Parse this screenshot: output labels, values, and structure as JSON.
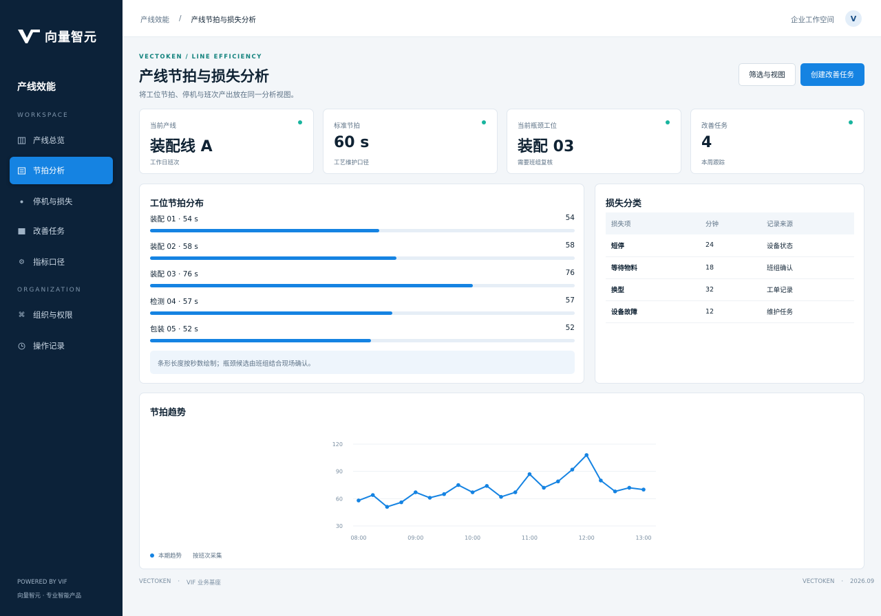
{
  "sidebar": {
    "brand": "向量智元",
    "title": "产线效能",
    "section_workspace": "WORKSPACE",
    "section_org": "ORGANIZATION",
    "items": [
      {
        "label": "产线总览",
        "icon": "columns-icon"
      },
      {
        "label": "节拍分析",
        "icon": "list-icon",
        "active": true
      },
      {
        "label": "停机与损失",
        "icon": "dot-icon"
      },
      {
        "label": "改善任务",
        "icon": "grid-icon"
      },
      {
        "label": "指标口径",
        "icon": "gear-icon"
      },
      {
        "label": "组织与权限",
        "icon": "command-icon"
      },
      {
        "label": "操作记录",
        "icon": "clock-icon"
      }
    ],
    "footer_line1": "POWERED BY VIF",
    "footer_line2": "向量智元 · 专业智能产品"
  },
  "topbar": {
    "breadcrumb_root": "产线效能",
    "breadcrumb_sep": "/",
    "breadcrumb_current": "产线节拍与损失分析",
    "workspace": "企业工作空间",
    "avatar": "V"
  },
  "header": {
    "eyebrow": "VECTOKEN / LINE EFFICIENCY",
    "title": "产线节拍与损失分析",
    "subtitle": "将工位节拍、停机与班次产出放在同一分析视图。",
    "filter_button": "筛选与视图",
    "create_button": "创建改善任务"
  },
  "kpis": [
    {
      "label": "当前产线",
      "value": "装配线 A",
      "sub": "工作日班次"
    },
    {
      "label": "标准节拍",
      "value": "60 s",
      "sub": "工艺维护口径"
    },
    {
      "label": "当前瓶颈工位",
      "value": "装配 03",
      "sub": "需要班组复核"
    },
    {
      "label": "改善任务",
      "value": "4",
      "sub": "本周跟踪"
    }
  ],
  "distribution": {
    "title": "工位节拍分布",
    "max": 100,
    "rows": [
      {
        "label": "装配 01 · 54 s",
        "value": 54,
        "display": "54"
      },
      {
        "label": "装配 02 · 58 s",
        "value": 58,
        "display": "58"
      },
      {
        "label": "装配 03 · 76 s",
        "value": 76,
        "display": "76"
      },
      {
        "label": "检测 04 · 57 s",
        "value": 57,
        "display": "57"
      },
      {
        "label": "包装 05 · 52 s",
        "value": 52,
        "display": "52"
      }
    ],
    "note": "条形长度按秒数绘制；瓶颈候选由班组结合现场确认。"
  },
  "loss": {
    "title": "损失分类",
    "headers": [
      "损失项",
      "分钟",
      "记录来源"
    ],
    "rows": [
      [
        "短停",
        "24",
        "设备状态"
      ],
      [
        "等待物料",
        "18",
        "班组确认"
      ],
      [
        "换型",
        "32",
        "工单记录"
      ],
      [
        "设备故障",
        "12",
        "维护任务"
      ]
    ]
  },
  "trend": {
    "title": "节拍趋势",
    "legend_series": "本期趋势",
    "legend_note": "按班次采集"
  },
  "chart_data": {
    "type": "line",
    "x": [
      "08:00",
      "08:15",
      "08:30",
      "08:45",
      "09:00",
      "09:15",
      "09:30",
      "09:45",
      "10:00",
      "10:15",
      "10:30",
      "10:45",
      "11:00",
      "11:15",
      "11:30",
      "11:45",
      "12:00",
      "12:15",
      "12:30",
      "12:45",
      "13:00"
    ],
    "xticks": [
      "08:00",
      "09:00",
      "10:00",
      "11:00",
      "12:00",
      "13:00"
    ],
    "series": [
      {
        "name": "本期趋势",
        "values": [
          58,
          64,
          51,
          56,
          67,
          61,
          65,
          75,
          67,
          74,
          62,
          67,
          87,
          72,
          79,
          92,
          108,
          80,
          68,
          72,
          70
        ]
      }
    ],
    "ylim": [
      30,
      120
    ],
    "yticks": [
      30,
      60,
      90,
      120
    ],
    "grid": true,
    "color": "#1583e2"
  },
  "footer": {
    "left_brand": "VECTOKEN",
    "left_sep": "·",
    "left_text": "VIF 业务基座",
    "right_brand": "VECTOKEN",
    "right_sep": "·",
    "right_date": "2026.09"
  }
}
